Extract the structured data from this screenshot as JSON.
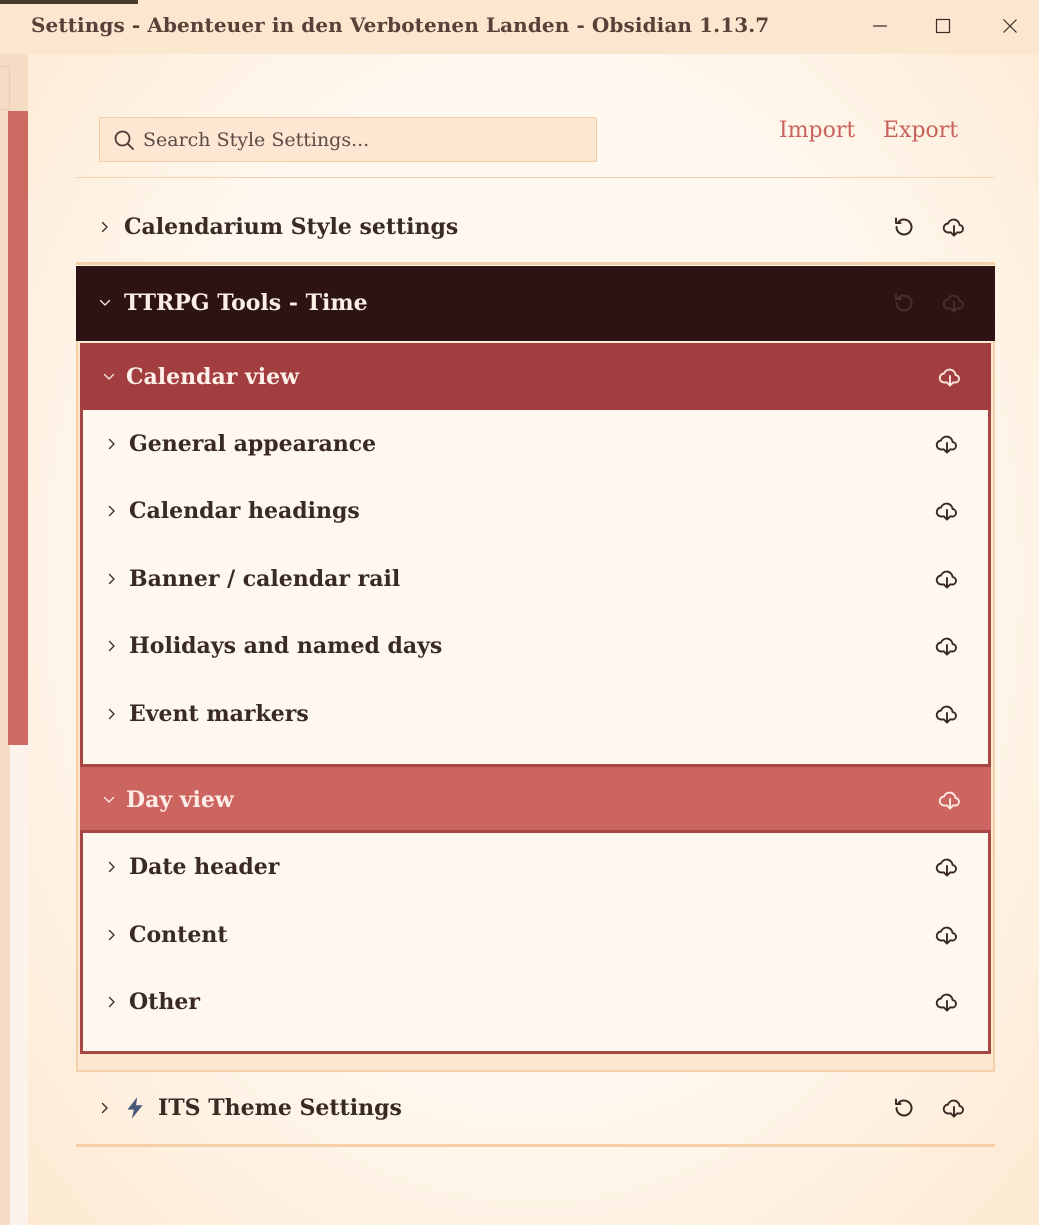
{
  "window": {
    "title": "Settings - Abenteuer in den Verbotenen Landen - Obsidian 1.13.7"
  },
  "search": {
    "placeholder": "Search Style Settings..."
  },
  "actions": {
    "import_label": "Import",
    "export_label": "Export"
  },
  "sections": [
    {
      "label": "Calendarium Style settings",
      "expanded": false
    },
    {
      "label": "TTRPG Tools - Time",
      "expanded": true,
      "groups": [
        {
          "label": "Calendar view",
          "expanded": true,
          "items": [
            "General appearance",
            "Calendar headings",
            "Banner / calendar rail",
            "Holidays and named days",
            "Event markers"
          ]
        },
        {
          "label": "Day view",
          "expanded": true,
          "items": [
            "Date header",
            "Content",
            "Other"
          ]
        }
      ]
    },
    {
      "label": "ITS Theme Settings",
      "expanded": false,
      "icon": "lightning-icon"
    }
  ],
  "colors": {
    "accent": "#c9625c",
    "dark_header": "#2d1314",
    "calendar_view_header": "#a23e40",
    "day_view_header": "#cc6560",
    "background": "#fff8ef"
  }
}
